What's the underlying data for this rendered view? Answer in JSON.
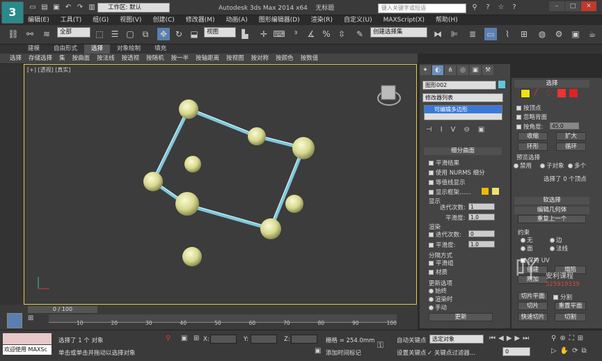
{
  "app": {
    "title": "Autodesk 3ds Max  2014 x64",
    "doc": "无标题",
    "workspace_label": "工作区: 默认",
    "search_placeholder": "键入关键字或短语"
  },
  "menu": [
    "编辑(E)",
    "工具(T)",
    "组(G)",
    "视图(V)",
    "创建(C)",
    "修改器(M)",
    "动画(A)",
    "图形编辑器(D)",
    "渲染(R)",
    "自定义(U)",
    "MAXScript(X)",
    "帮助(H)"
  ],
  "toolbar": {
    "filter": "全部",
    "refcoord": "视图",
    "selset": "创建选择集"
  },
  "ribbon_tabs": [
    "建模",
    "自由形式",
    "选择",
    "对象绘制",
    "填充"
  ],
  "ribbon_items": [
    "选择",
    "存储选择",
    "集",
    "按曲面",
    "按法线",
    "按透视",
    "按随机",
    "按一半",
    "按轴距离",
    "按视图",
    "按对称",
    "按颜色",
    "按数值"
  ],
  "viewport": {
    "label": "[+] [透视] [真实]"
  },
  "cmd": {
    "obj_name": "图形002",
    "mod_list": "修改器列表",
    "stack_item": "可编辑多边形",
    "subdiv_title": "细分曲面",
    "smooth_result": "平滑结果",
    "use_nurms": "使用 NURMS 细分",
    "isoline": "等值线显示",
    "show_cage": "显示框架……",
    "display": "显示",
    "iterations": "迭代次数:",
    "iter_val": "1",
    "smoothness": "平滑度:",
    "smooth_val": "1.0",
    "render": "渲染",
    "r_iter_val": "0",
    "r_smooth_val": "1.0",
    "sep_by": "分隔方式",
    "smooth_groups": "平滑组",
    "materials": "材质",
    "update_opts": "更新选项",
    "always": "始终",
    "when_render": "渲染时",
    "manual": "手动",
    "update_btn": "更新"
  },
  "right": {
    "sel_title": "选择",
    "by_vertex": "按顶点",
    "ignore_back": "忽略背面",
    "by_angle": "按角度:",
    "angle_val": "45.0",
    "shrink": "收缩",
    "grow": "扩大",
    "ring": "环形",
    "loop": "循环",
    "preview": "预览选择",
    "disable": "禁用",
    "subobj": "子对象",
    "multi": "多个",
    "selected": "选择了 0 个顶点",
    "soft_sel": "软选择",
    "edit_geom": "编辑几何体",
    "repeat": "重复上一个",
    "constraints": "约束",
    "none": "无",
    "edge": "边",
    "face": "面",
    "normal": "法线",
    "keep_uv": "保持 UV",
    "create": "创建",
    "collapse": "塌陷",
    "attach": "附加",
    "slice_plane": "切片平面",
    "split": "分割",
    "slice": "切片",
    "reset_plane": "重置平面",
    "quickslice": "快速切片",
    "cut": "切割",
    "watermark": "安利课程",
    "watermark_num": "525919339"
  },
  "timeline": {
    "frame": "0 / 100",
    "ticks": [
      "10",
      "20",
      "30",
      "40",
      "50",
      "60",
      "70",
      "80",
      "90",
      "100"
    ]
  },
  "status": {
    "maxscript": "欢迎使用 MAXSc",
    "selected": "选择了 1 个 对象",
    "hint": "单击或单击并拖动以选择对象",
    "x_label": "X:",
    "y_label": "Y:",
    "z_label": "Z:",
    "grid": "栅格 = 254.0mm",
    "auto_key": "自动关键点",
    "set_key": "设置关键点",
    "sel_obj": "选定对象",
    "key_filter": "关键点过滤器...",
    "add_time_tag": "添加时间标记",
    "frame_val": "0"
  }
}
